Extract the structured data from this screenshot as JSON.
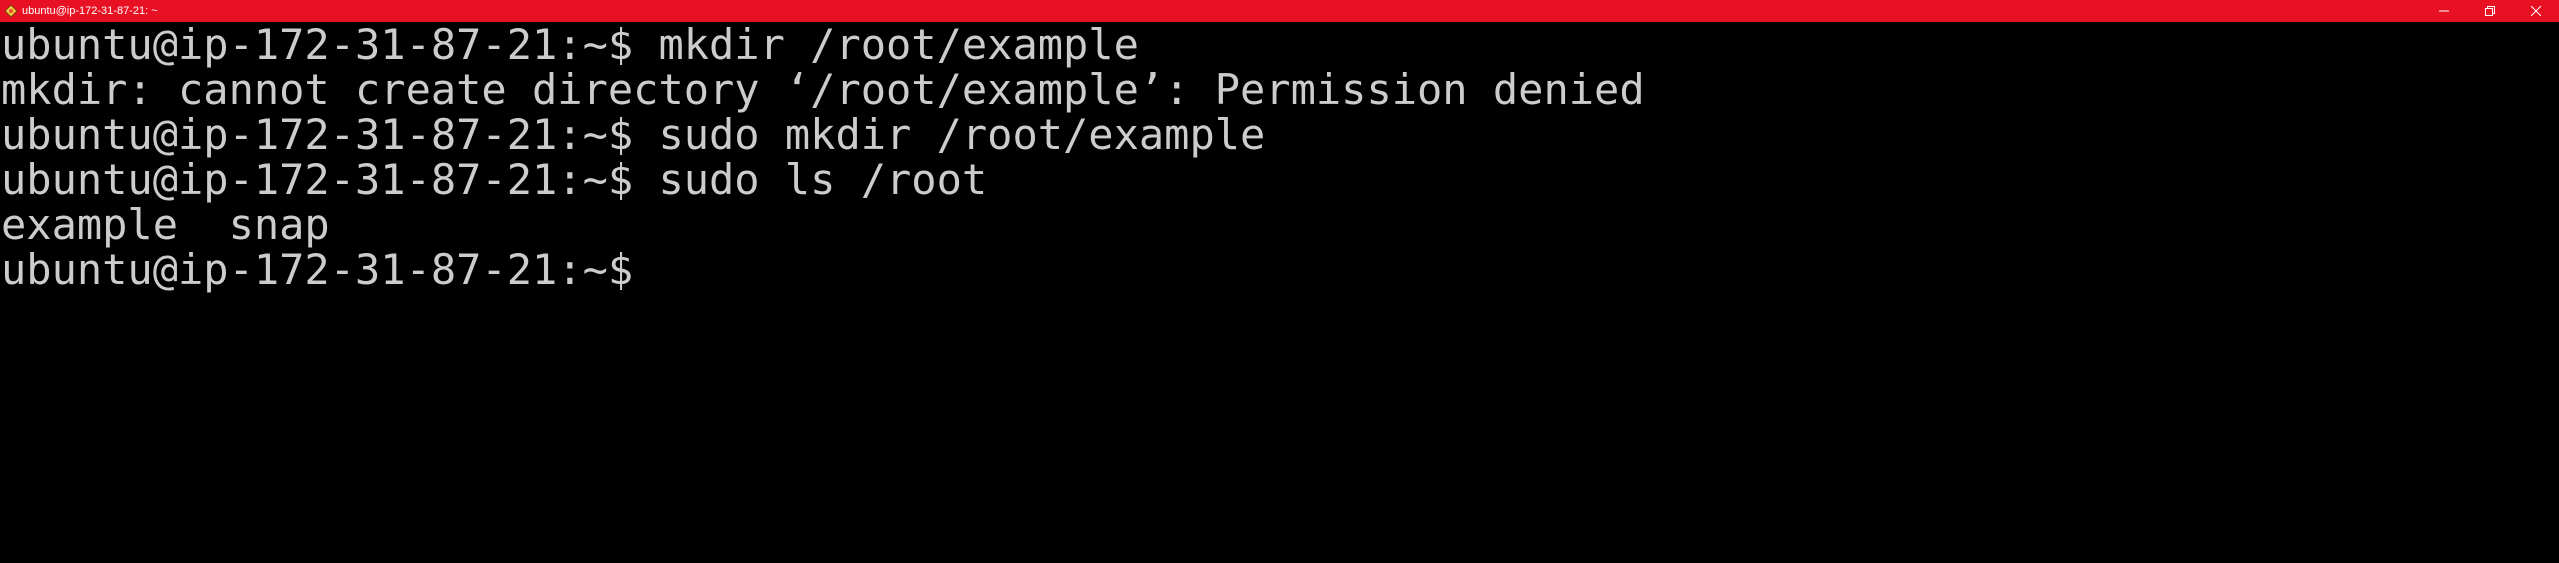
{
  "window": {
    "title": "ubuntu@ip-172-31-87-21: ~",
    "accent": "#e81123",
    "background": "#000000",
    "foreground": "#cccccc",
    "icon": "ubuntu-terminal-icon",
    "controls": {
      "minimize": "minimize-icon",
      "maximize": "restore-icon",
      "close": "close-icon"
    }
  },
  "terminal": {
    "lines": [
      "ubuntu@ip-172-31-87-21:~$ mkdir /root/example",
      "mkdir: cannot create directory ‘/root/example’: Permission denied",
      "ubuntu@ip-172-31-87-21:~$ sudo mkdir /root/example",
      "ubuntu@ip-172-31-87-21:~$ sudo ls /root",
      "example  snap",
      "ubuntu@ip-172-31-87-21:~$ "
    ]
  }
}
